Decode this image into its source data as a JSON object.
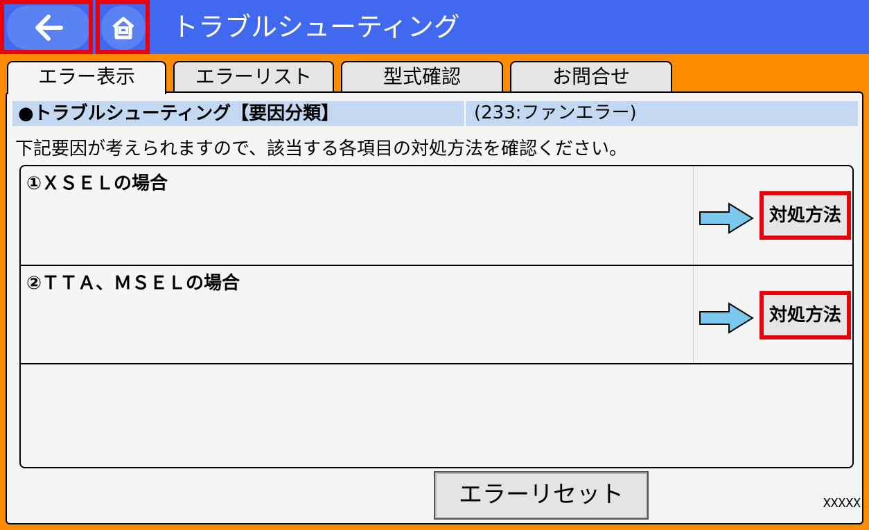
{
  "header": {
    "title": "トラブルシューティング"
  },
  "tabs": [
    {
      "label": "エラー表示"
    },
    {
      "label": "エラーリスト"
    },
    {
      "label": "型式確認"
    },
    {
      "label": "お問合せ"
    }
  ],
  "breadcrumb": {
    "title": "●トラブルシューティング【要因分類】",
    "error": "(233:ファンエラー)"
  },
  "instruction": "下記要因が考えられますので、該当する各項目の対処方法を確認ください。",
  "rows": [
    {
      "label": "①ＸＳＥＬの場合",
      "button": "対処方法"
    },
    {
      "label": "②ＴＴＡ、ＭＳＥＬの場合",
      "button": "対処方法"
    }
  ],
  "reset_button": "エラーリセット",
  "footer_code": "XXXXX",
  "colors": {
    "header": "#4169f0",
    "frame": "#ff8c00",
    "highlight": "#e8000b",
    "breadcrumb": "#c4d9f1",
    "arrow": "#7ac8ee"
  },
  "icons": {
    "back": "arrow-left-icon",
    "home": "home-icon",
    "row_arrow": "arrow-right-icon"
  }
}
